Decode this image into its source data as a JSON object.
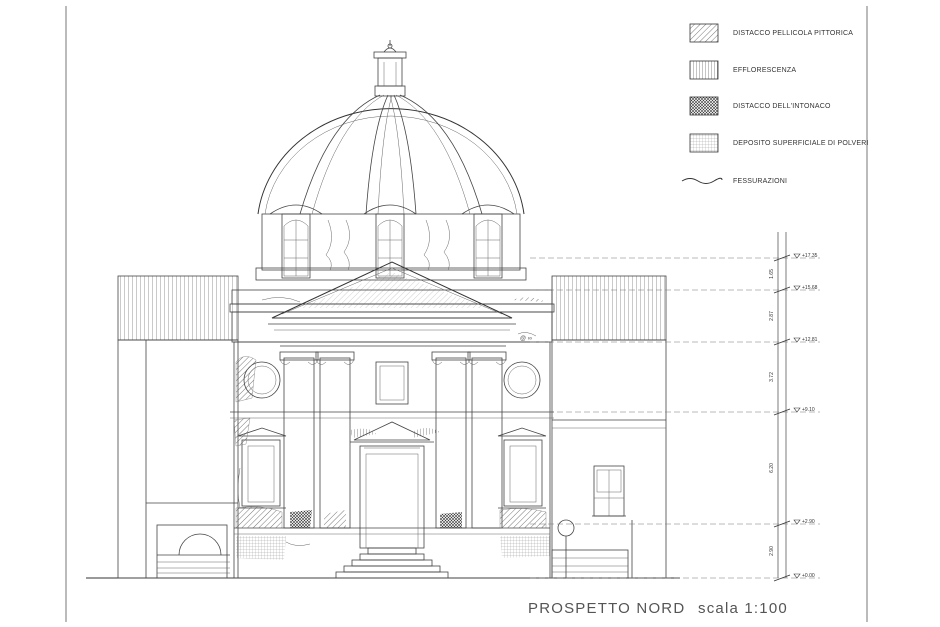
{
  "legend": {
    "items": [
      {
        "label": "DISTACCO PELLICOLA PITTORICA",
        "pattern": "diagonal-hatch"
      },
      {
        "label": "EFFLORESCENZA",
        "pattern": "vertical-hatch"
      },
      {
        "label": "DISTACCO DELL'INTONACO",
        "pattern": "cross-hatch"
      },
      {
        "label": "DEPOSITO SUPERFICIALE  DI POLVERI",
        "pattern": "fine-grid"
      },
      {
        "label": "FESSURAZIONI",
        "pattern": "wavy-line"
      }
    ]
  },
  "elevations": [
    {
      "label": "+17.35"
    },
    {
      "label": "+15.68"
    },
    {
      "label": "+12.81"
    },
    {
      "label": "+9.10"
    },
    {
      "label": "+2.90"
    },
    {
      "label": "+0.00"
    }
  ],
  "dimensions": [
    "1.65",
    "2.87",
    "3.72",
    "6.20",
    "2.90"
  ],
  "title": {
    "name": "PROSPETTO NORD",
    "scale": "scala 1:100"
  },
  "colors": {
    "line": "#444444",
    "paper": "#ffffff"
  }
}
